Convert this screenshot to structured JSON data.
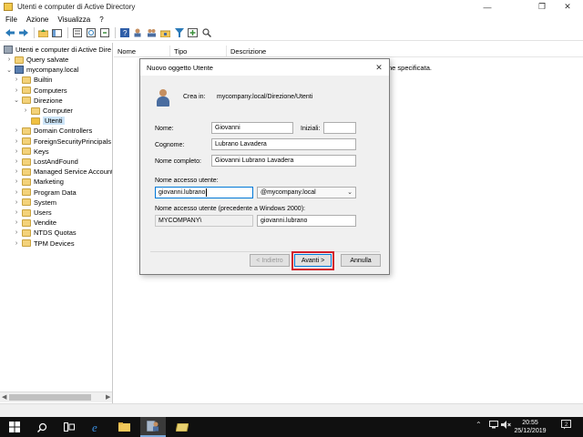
{
  "window": {
    "title": "Utenti e computer di Active Directory",
    "controls": {
      "minimize": "—",
      "maximize": "❐",
      "close": "✕"
    }
  },
  "menu": [
    "File",
    "Azione",
    "Visualizza",
    "?"
  ],
  "toolbar": [
    "arrow-left-icon",
    "arrow-right-icon",
    "folder-up-icon",
    "console-tree-icon",
    "properties-icon",
    "refresh-icon",
    "export-icon",
    "help-icon",
    "new-user-icon",
    "new-group-icon",
    "new-ou-icon",
    "filter-icon",
    "add-to-group-icon",
    "find-icon"
  ],
  "tree": {
    "root": "Utenti e computer di Active Dire",
    "items": [
      {
        "label": "Query salvate",
        "expander": ">",
        "level": 1
      },
      {
        "label": "mycompany.local",
        "expander": "v",
        "level": 1,
        "icon": "domain"
      },
      {
        "label": "Builtin",
        "expander": ">",
        "level": 2
      },
      {
        "label": "Computers",
        "expander": ">",
        "level": 2
      },
      {
        "label": "Direzione",
        "expander": "v",
        "level": 2
      },
      {
        "label": "Computer",
        "expander": ">",
        "level": 3
      },
      {
        "label": "Utenti",
        "expander": "",
        "level": 3,
        "selected": true
      },
      {
        "label": "Domain Controllers",
        "expander": ">",
        "level": 2
      },
      {
        "label": "ForeignSecurityPrincipals",
        "expander": ">",
        "level": 2
      },
      {
        "label": "Keys",
        "expander": ">",
        "level": 2
      },
      {
        "label": "LostAndFound",
        "expander": ">",
        "level": 2
      },
      {
        "label": "Managed Service Accounts",
        "expander": ">",
        "level": 2
      },
      {
        "label": "Marketing",
        "expander": ">",
        "level": 2
      },
      {
        "label": "Program Data",
        "expander": ">",
        "level": 2
      },
      {
        "label": "System",
        "expander": ">",
        "level": 2
      },
      {
        "label": "Users",
        "expander": ">",
        "level": 2
      },
      {
        "label": "Vendite",
        "expander": ">",
        "level": 2
      },
      {
        "label": "NTDS Quotas",
        "expander": ">",
        "level": 2
      },
      {
        "label": "TPM Devices",
        "expander": ">",
        "level": 2
      }
    ]
  },
  "list": {
    "columns": [
      "Nome",
      "Tipo",
      "Descrizione"
    ],
    "message": "ne specificata."
  },
  "dialog": {
    "title": "Nuovo oggetto Utente",
    "close": "✕",
    "create_in_label": "Crea in:",
    "create_in_value": "mycompany.local/Direzione/Utenti",
    "first_name_label": "Nome:",
    "first_name_value": "Giovanni",
    "initials_label": "Iniziali:",
    "initials_value": "",
    "last_name_label": "Cognome:",
    "last_name_value": "Lubrano Lavadera",
    "full_name_label": "Nome completo:",
    "full_name_value": "Giovanni Lubrano Lavadera",
    "logon_label": "Nome accesso utente:",
    "logon_value": "giovanni.lubrano",
    "domain_suffix": "@mycompany.local",
    "pre2000_label": "Nome accesso utente (precedente a Windows 2000):",
    "pre2000_domain": "MYCOMPANY\\",
    "pre2000_value": "giovanni.lubrano",
    "back_button": "< Indietro",
    "next_button": "Avanti >",
    "cancel_button": "Annulla"
  },
  "taskbar": {
    "time": "20:55",
    "date": "25/12/2019"
  }
}
